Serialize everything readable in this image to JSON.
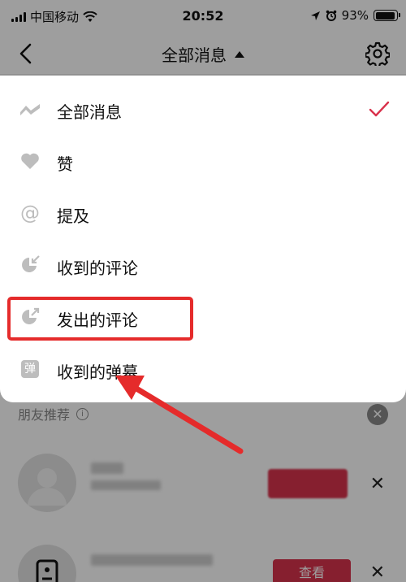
{
  "status_bar": {
    "carrier": "中国移动",
    "time": "20:52",
    "battery": "93%",
    "battery_level": 0.93
  },
  "nav": {
    "title": "全部消息"
  },
  "menu": {
    "items": [
      {
        "label": "全部消息",
        "icon": "wave-icon",
        "selected": true
      },
      {
        "label": "赞",
        "icon": "heart-icon"
      },
      {
        "label": "提及",
        "icon": "at-icon"
      },
      {
        "label": "收到的评论",
        "icon": "comment-in-icon"
      },
      {
        "label": "发出的评论",
        "icon": "comment-out-icon"
      },
      {
        "label": "收到的弹幕",
        "icon": "danmu-icon",
        "icon_text": "弹"
      }
    ]
  },
  "friends": {
    "title": "朋友推荐",
    "view_button": "查看"
  },
  "colors": {
    "accent": "#d9324c",
    "annotation": "#e52b2b"
  }
}
